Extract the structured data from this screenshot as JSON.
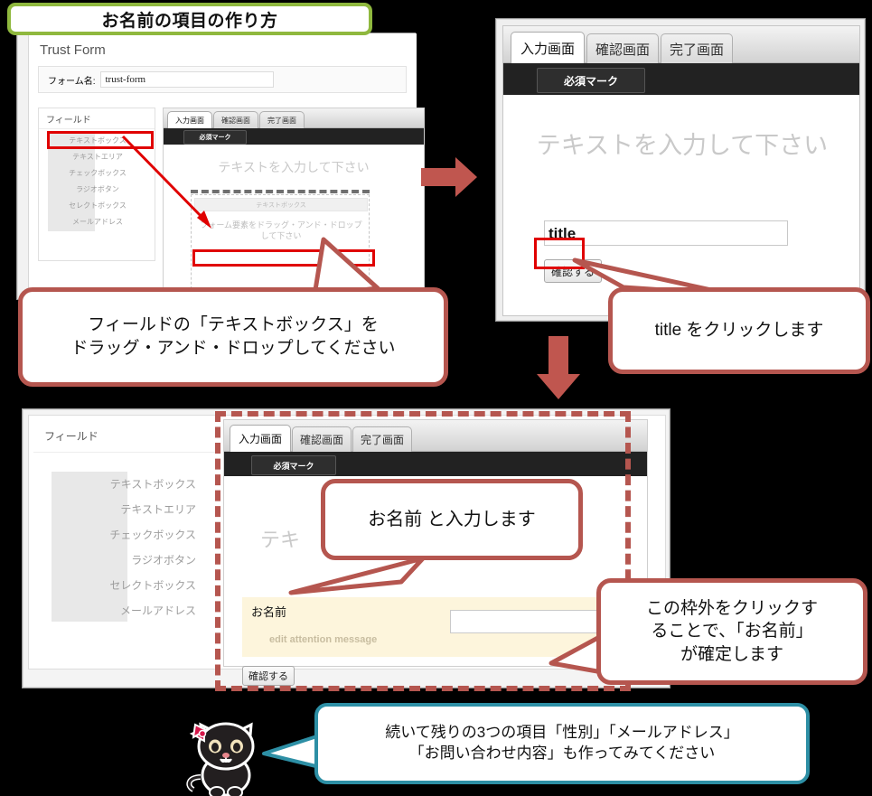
{
  "banner": {
    "title": "お名前の項目の作り方",
    "border_color": "#8fb83e"
  },
  "colors": {
    "accent_red": "#b5564f",
    "arrow_red": "#c0564f",
    "teal": "#2d8fa5",
    "highlight_red": "#e00000",
    "yellow_row": "#fdf5dc"
  },
  "panel_top_left": {
    "app_title": "Trust Form",
    "form_name_label": "フォーム名:",
    "form_name_value": "trust-form",
    "fields_heading": "フィールド",
    "field_items": [
      "テキストボックス",
      "テキストエリア",
      "チェックボックス",
      "ラジオボタン",
      "セレクトボックス",
      "メールアドレス"
    ],
    "tabs": [
      {
        "label": "入力画面",
        "active": true
      },
      {
        "label": "確認画面",
        "active": false
      },
      {
        "label": "完了画面",
        "active": false
      }
    ],
    "required_mark": "必須マーク",
    "ghost_heading": "テキストを入力して下さい",
    "drop_item_label": "テキストボックス",
    "drop_hint_line1": "フォーム要素をドラッグ・アンド・ドロップ",
    "drop_hint_line2": "して下さい"
  },
  "panel_top_right": {
    "tabs": [
      {
        "label": "入力画面",
        "active": true
      },
      {
        "label": "確認画面",
        "active": false
      },
      {
        "label": "完了画面",
        "active": false
      }
    ],
    "required_mark": "必須マーク",
    "ghost_heading": "テキストを入力して下さい",
    "title_field_value": "title",
    "submit_label": "確認する"
  },
  "panel_bottom": {
    "fields_heading": "フィールド",
    "field_items": [
      "テキストボックス",
      "テキストエリア",
      "チェックボックス",
      "ラジオボタン",
      "セレクトボックス",
      "メールアドレス"
    ],
    "tabs": [
      {
        "label": "入力画面",
        "active": true
      },
      {
        "label": "確認画面",
        "active": false
      },
      {
        "label": "完了画面",
        "active": false
      }
    ],
    "required_mark": "必須マーク",
    "ghost_heading": "テキ",
    "name_field_label": "お名前",
    "attention_message": "edit attention message",
    "submit_label": "確認する"
  },
  "callouts": {
    "drag_drop": "フィールドの「テキストボックス」を\nドラッグ・アンド・ドロップしてください",
    "drag_drop_line1": "フィールドの「テキストボックス」を",
    "drag_drop_line2": "ドラッグ・アンド・ドロップしてください",
    "click_title": "title をクリックします",
    "type_name": "お名前 と入力します",
    "outside_click_line1": "この枠外をクリックす",
    "outside_click_line2": "ることで、「お名前」",
    "outside_click_line3": "が確定します",
    "cat_line1": "続いて残りの3つの項目「性別」「メールアドレス」",
    "cat_line2": "「お問い合わせ内容」も作ってみてください"
  },
  "icons": {
    "arrow_right": "arrow-right-icon",
    "arrow_down": "arrow-down-icon",
    "mascot": "cat-mascot-icon"
  }
}
